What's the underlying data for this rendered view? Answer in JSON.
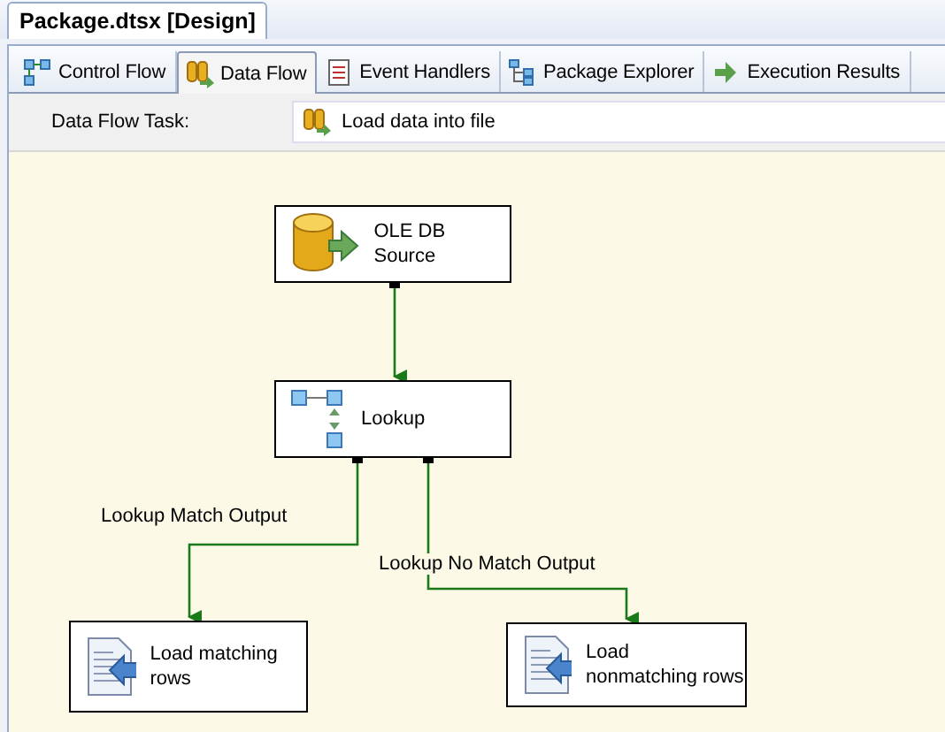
{
  "document_tab": {
    "title": "Package.dtsx [Design]"
  },
  "tabs": [
    {
      "label": "Control Flow",
      "selected": false,
      "kind": "control"
    },
    {
      "label": "Data Flow",
      "selected": true,
      "kind": "data"
    },
    {
      "label": "Event Handlers",
      "selected": false,
      "kind": "events"
    },
    {
      "label": "Package Explorer",
      "selected": false,
      "kind": "explorer"
    },
    {
      "label": "Execution Results",
      "selected": false,
      "kind": "results"
    }
  ],
  "task": {
    "label": "Data Flow Task:",
    "value": "Load data into file"
  },
  "nodes": [
    {
      "label": "OLE DB Source",
      "kind": "source"
    },
    {
      "label": "Lookup",
      "kind": "lookup"
    },
    {
      "label": "Load matching rows",
      "kind": "destination"
    },
    {
      "label": "Load nonmatching rows",
      "kind": "destination"
    }
  ],
  "edges": [
    {
      "kind": "flow"
    },
    {
      "kind": "flow",
      "label": "Lookup Match Output"
    },
    {
      "kind": "flow",
      "label": "Lookup No Match Output"
    }
  ]
}
